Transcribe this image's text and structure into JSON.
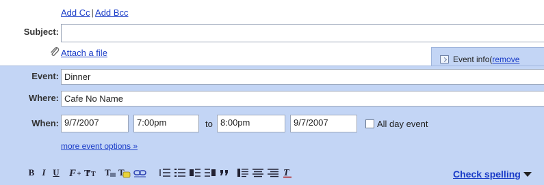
{
  "compose": {
    "add_cc": "Add Cc",
    "separator": "|",
    "add_bcc": "Add Bcc",
    "subject_label": "Subject:",
    "subject_value": "",
    "attach_label": "Attach a file"
  },
  "event_tab": {
    "label": "Event info",
    "open_paren": " (",
    "remove_label": "remove"
  },
  "event": {
    "event_label": "Event:",
    "event_value": "Dinner",
    "where_label": "Where:",
    "where_value": "Cafe No Name",
    "when_label": "When:",
    "start_date": "9/7/2007",
    "start_time": "7:00pm",
    "to_label": "to",
    "end_time": "8:00pm",
    "end_date": "9/7/2007",
    "all_day_label": "All day event",
    "all_day_checked": false,
    "more_options": "more event options »"
  },
  "toolbar": {
    "bold": "B",
    "italic": "I",
    "underline": "U",
    "check_spelling": "Check spelling",
    "icons": [
      "font-icon",
      "font-size-icon",
      "text-color-icon",
      "highlight-color-icon",
      "link-icon",
      "numbered-list-icon",
      "bulleted-list-icon",
      "indent-less-icon",
      "indent-more-icon",
      "quote-icon",
      "align-left-icon",
      "align-center-icon",
      "align-right-icon",
      "remove-formatting-icon",
      "chevron-down-icon"
    ]
  },
  "colors": {
    "panel": "#c3d5f5",
    "link": "#1a3cc8",
    "border": "#9aa5b8"
  }
}
